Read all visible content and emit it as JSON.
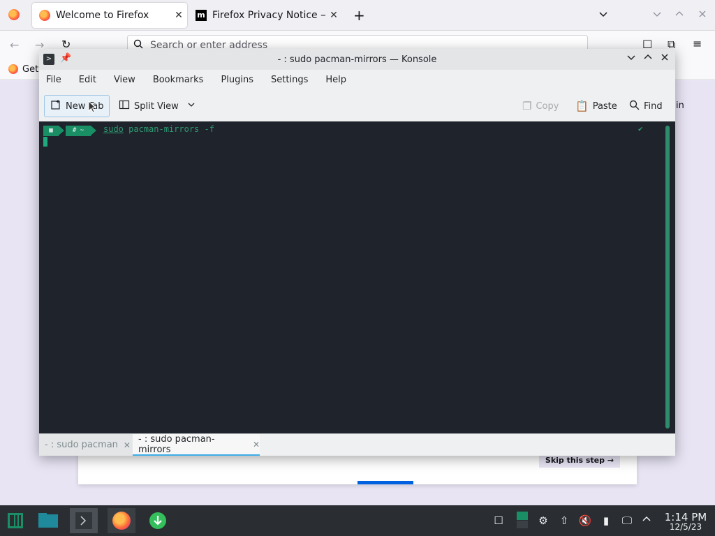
{
  "firefox": {
    "tabs": [
      {
        "label": "Welcome to Firefox",
        "close": "✕"
      },
      {
        "label": "Firefox Privacy Notice — M",
        "close": "✕"
      }
    ],
    "new_tab": "+",
    "url_placeholder": "Search or enter address",
    "bookmark_label": "Get",
    "sign_in_peek": "in",
    "skip_label": "Skip this step →"
  },
  "konsole": {
    "title": "- : sudo pacman-mirrors — Konsole",
    "menu": [
      "File",
      "Edit",
      "View",
      "Bookmarks",
      "Plugins",
      "Settings",
      "Help"
    ],
    "toolbar": {
      "new_tab": "New Tab",
      "split_view": "Split View",
      "copy": "Copy",
      "paste": "Paste",
      "find": "Find"
    },
    "prompt": {
      "seg1": "▦",
      "seg2": "# ~"
    },
    "command": {
      "sudo": "sudo",
      "rest": " pacman-mirrors -f"
    },
    "status_mark": "✔",
    "tabs": [
      {
        "label": "- : sudo pacman",
        "close": "✕"
      },
      {
        "label": "- : sudo pacman-mirrors",
        "close": "✕"
      }
    ]
  },
  "taskbar": {
    "time": "1:14 PM",
    "date": "12/5/23"
  },
  "colors": {
    "terminal_bg": "#1f232b",
    "prompt_green": "#1a8f66",
    "accent_blue": "#3daee9",
    "taskbar_bg": "#2a2e32"
  }
}
